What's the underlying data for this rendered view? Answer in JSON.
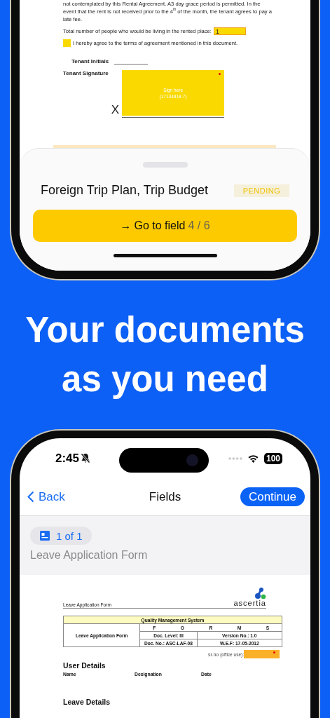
{
  "top_phone": {
    "document": {
      "paragraph_lines": [
        "not contemplated by this Rental Agreement.  A3 day grace period is permitted.  In the",
        "event that the rent is not received prior to the 4$^{th}$ of the month, the tenant agrees to pay a",
        "late fee."
      ],
      "occupants": {
        "label": "Total number of people who would be living in the rented place:",
        "value": "1"
      },
      "agreement": {
        "label": "I hereby agree to the terms of agreement mentioned in this document.",
        "checked": false
      },
      "initials_label": "Tenant Initials",
      "signature": {
        "label": "Tenant Signature",
        "hint_lines": [
          "Sign here",
          "(17134818-7)"
        ],
        "required": true,
        "mark": "X"
      }
    },
    "sheet": {
      "title": "Foreign Trip Plan, Trip Budget",
      "status": "PENDING",
      "button": {
        "arrow": "→",
        "label": "Go to field",
        "counter": "4 / 6"
      }
    }
  },
  "headline": [
    "Your documents",
    "as you need"
  ],
  "bottom_phone": {
    "status_bar": {
      "time": "2:45",
      "silent": true,
      "battery": "100"
    },
    "nav": {
      "back": "Back",
      "title": "Fields",
      "action": "Continue"
    },
    "page_chip": "1 of 1",
    "document_name": "Leave Application Form",
    "form": {
      "header_title": "Leave Application Form",
      "logo": "ascertia",
      "table": {
        "heading": "Quality Management System",
        "name": "Leave Application Form",
        "letters": [
          "F",
          "O",
          "R",
          "M",
          "S"
        ],
        "rows": [
          [
            "Doc. Level: III",
            "Version No.: 1.0"
          ],
          [
            "Doc. No.: ASC-LAF-08",
            "W.E.F: 17-05-2012"
          ]
        ]
      },
      "serial": {
        "label": "sr.no",
        "note": "(office use):",
        "required": true
      },
      "sections": [
        {
          "title": "User Details",
          "columns": [
            "Name",
            "Designation",
            "Date"
          ]
        },
        {
          "title": "Leave Details"
        }
      ]
    }
  }
}
